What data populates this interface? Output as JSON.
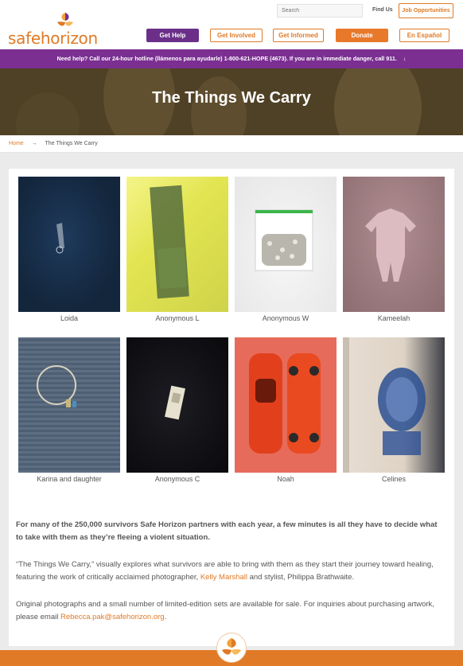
{
  "header": {
    "logo_text": "safehorizon",
    "search_placeholder": "Search",
    "find_us": "Find Us",
    "job_opportunities": "Job Opportunities"
  },
  "nav": {
    "get_help": "Get Help",
    "get_involved": "Get Involved",
    "get_informed": "Get Informed",
    "donate": "Donate",
    "en_espanol": "En Español"
  },
  "hotline": {
    "text": "Need help? Call our 24-hour hotline (llámenos para ayudarle) 1-800-621-HOPE (4673). If you are in immediate danger, call 911.",
    "arrow": "↓"
  },
  "hero": {
    "title": "The Things We Carry"
  },
  "breadcrumb": {
    "home": "Home",
    "separator": "→",
    "current": "The Things We Carry"
  },
  "gallery": [
    {
      "caption": "Loida"
    },
    {
      "caption": "Anonymous L"
    },
    {
      "caption": "Anonymous W"
    },
    {
      "caption": "Kameelah"
    },
    {
      "caption": "Karina and daughter"
    },
    {
      "caption": "Anonymous C"
    },
    {
      "caption": "Noah"
    },
    {
      "caption": "Celines"
    }
  ],
  "body": {
    "intro": "For many of the 250,000 survivors Safe Horizon partners with each year, a few minutes is all they have to decide what to take with them as they’re fleeing a violent situation.",
    "para2_before": "“The Things We Carry,” visually explores what survivors are able to bring with them as they start their journey toward healing, featuring the work of critically acclaimed photographer, ",
    "para2_link": "Kelly Marshall",
    "para2_after": " and stylist, Philippa Brathwaite.",
    "para3_before": "Original photographs and a small number of limited-edition sets are available for sale. For inquiries about purchasing artwork, please email ",
    "para3_link": "Rebecca.pak@safehorizon.org",
    "para3_after": "."
  },
  "colors": {
    "brand_orange": "#e07a26",
    "brand_purple": "#7a2f91",
    "help_purple": "#6b2f89"
  }
}
